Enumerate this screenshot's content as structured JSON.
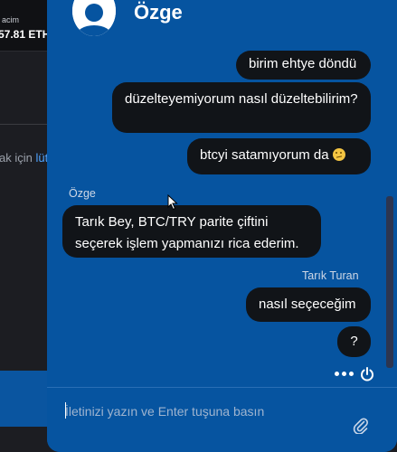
{
  "background_page": {
    "volume_label": "acim",
    "volume_value": "57.81 ETH",
    "notice_text": "ak için",
    "notice_link": "lüt"
  },
  "chat": {
    "agent_name": "Özge",
    "messages": [
      {
        "side": "right",
        "text": "birim ehtye döndü"
      },
      {
        "side": "right",
        "text": "düzelteyemiyorum nasıl düzeltebilirim?"
      },
      {
        "side": "right",
        "text": "btcyi satamıyorum da",
        "emoji": "confused-emoji-icon"
      },
      {
        "side": "left",
        "sender": "Özge",
        "text": "Tarık Bey, BTC/TRY parite çiftini seçerek işlem yapmanızı rica ederim."
      },
      {
        "side": "right",
        "sender": "Tarık Turan",
        "text": "nasıl seçeceğim"
      },
      {
        "side": "right",
        "text": "?"
      }
    ],
    "composer": {
      "placeholder": "İletinizi yazın ve Enter tuşuna basın",
      "attach_icon": "paperclip-icon"
    },
    "header_icons": {
      "more": "more-options-icon",
      "power": "power-icon"
    },
    "colors": {
      "panel": "#0654a0",
      "bubble": "#111418",
      "page_background": "#1c1d22",
      "link": "#4fa3ff"
    }
  }
}
